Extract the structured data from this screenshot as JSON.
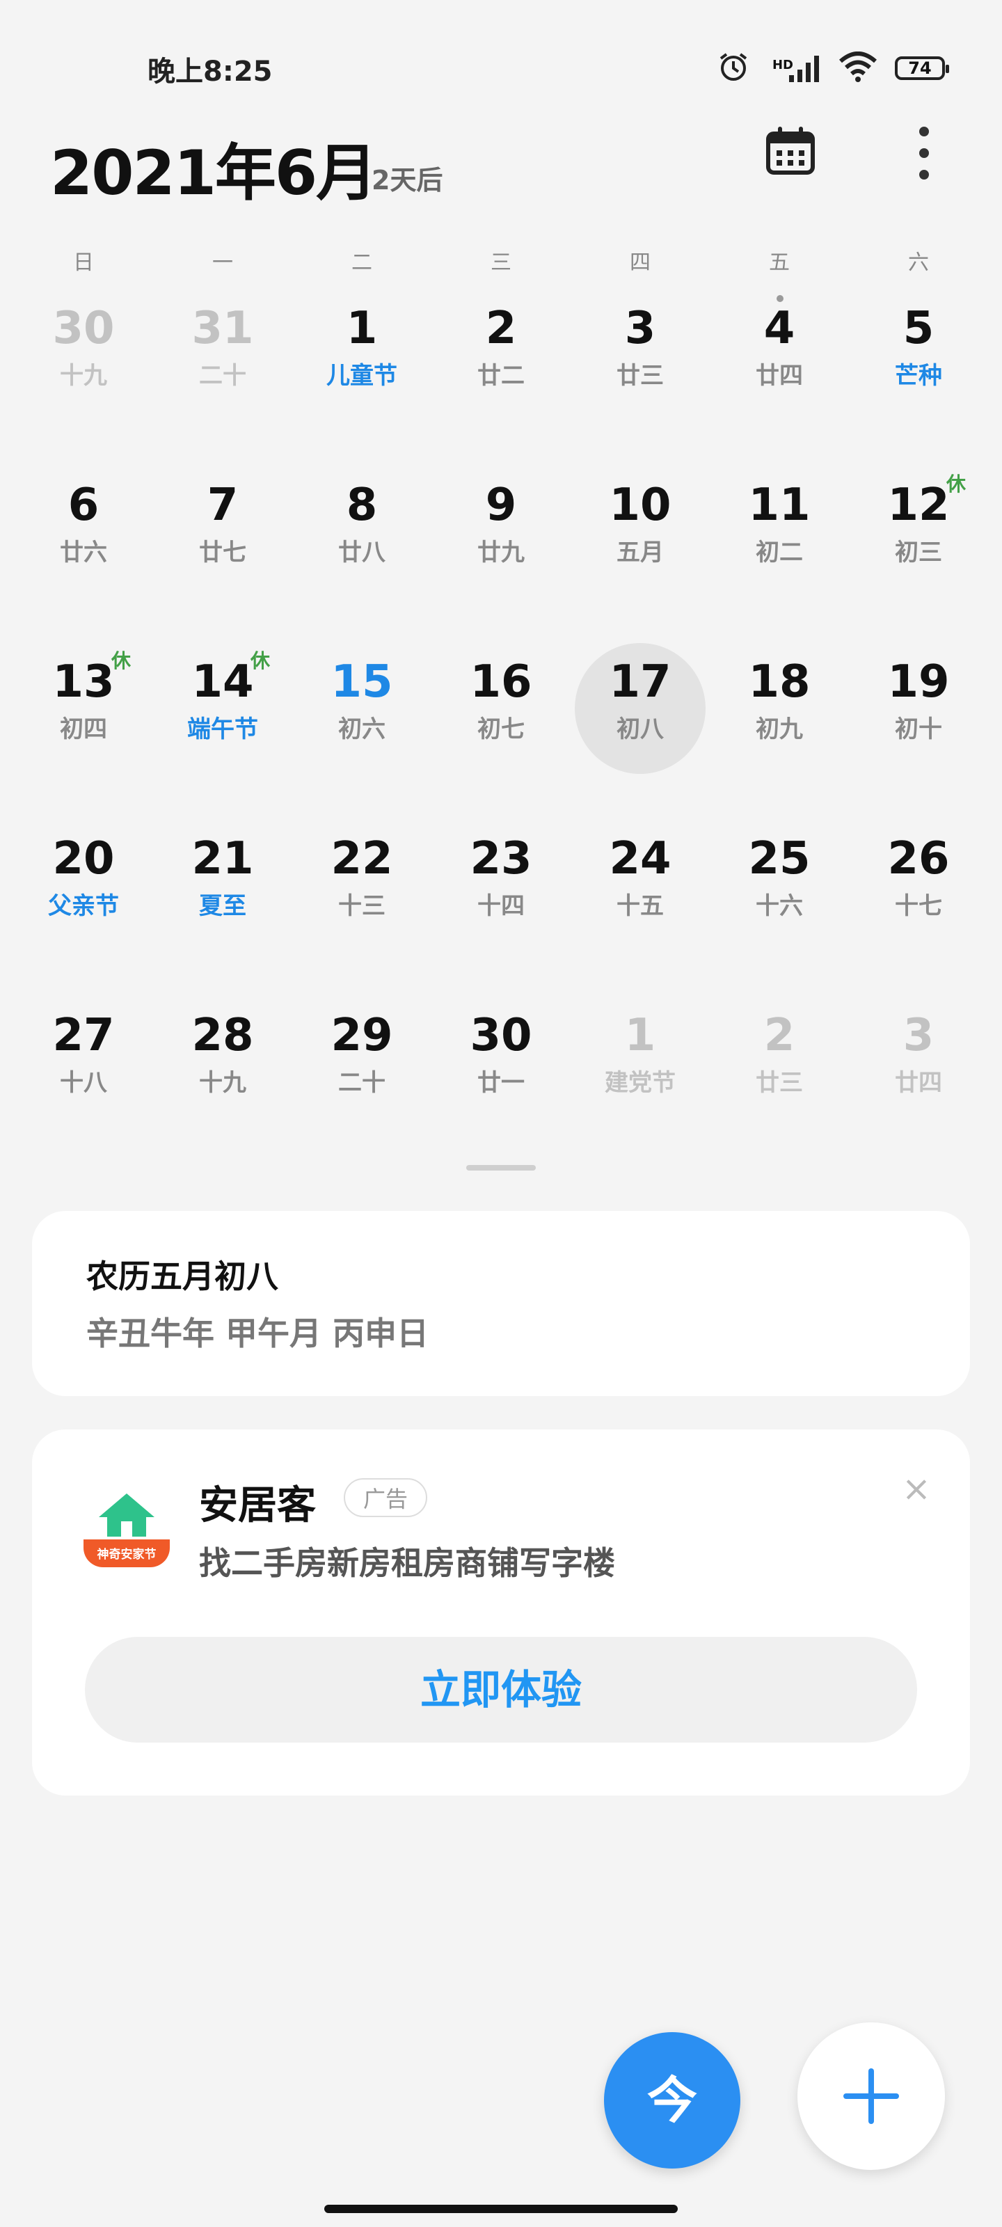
{
  "status_bar": {
    "time": "晚上8:25",
    "network": "HD",
    "battery": "74"
  },
  "header": {
    "title": "2021年6月",
    "subtitle": "2天后"
  },
  "weekdays": [
    "日",
    "一",
    "二",
    "三",
    "四",
    "五",
    "六"
  ],
  "days": [
    {
      "n": "30",
      "l": "十九"
    },
    {
      "n": "31",
      "l": "二十"
    },
    {
      "n": "1",
      "l": "儿童节"
    },
    {
      "n": "2",
      "l": "廿二"
    },
    {
      "n": "3",
      "l": "廿三"
    },
    {
      "n": "4",
      "l": "廿四"
    },
    {
      "n": "5",
      "l": "芒种"
    },
    {
      "n": "6",
      "l": "廿六"
    },
    {
      "n": "7",
      "l": "廿七"
    },
    {
      "n": "8",
      "l": "廿八"
    },
    {
      "n": "9",
      "l": "廿九"
    },
    {
      "n": "10",
      "l": "五月"
    },
    {
      "n": "11",
      "l": "初二"
    },
    {
      "n": "12",
      "l": "初三",
      "rest": "休"
    },
    {
      "n": "13",
      "l": "初四",
      "rest": "休"
    },
    {
      "n": "14",
      "l": "端午节",
      "rest": "休"
    },
    {
      "n": "15",
      "l": "初六"
    },
    {
      "n": "16",
      "l": "初七"
    },
    {
      "n": "17",
      "l": "初八"
    },
    {
      "n": "18",
      "l": "初九"
    },
    {
      "n": "19",
      "l": "初十"
    },
    {
      "n": "20",
      "l": "父亲节"
    },
    {
      "n": "21",
      "l": "夏至"
    },
    {
      "n": "22",
      "l": "十三"
    },
    {
      "n": "23",
      "l": "十四"
    },
    {
      "n": "24",
      "l": "十五"
    },
    {
      "n": "25",
      "l": "十六"
    },
    {
      "n": "26",
      "l": "十七"
    },
    {
      "n": "27",
      "l": "十八"
    },
    {
      "n": "28",
      "l": "十九"
    },
    {
      "n": "29",
      "l": "二十"
    },
    {
      "n": "30",
      "l": "廿一"
    },
    {
      "n": "1",
      "l": "建党节"
    },
    {
      "n": "2",
      "l": "廿三"
    },
    {
      "n": "3",
      "l": "廿四"
    }
  ],
  "lunar_card": {
    "title": "农历五月初八",
    "detail": "辛丑牛年 甲午月 丙申日"
  },
  "ad_card": {
    "app_name": "安居客",
    "tag": "广告",
    "description": "找二手房新房租房商铺写字楼",
    "icon_label": "神奇安家节",
    "cta": "立即体验",
    "close": "×"
  },
  "fab": {
    "today_label": "今"
  },
  "colors": {
    "accent": "#2196f3",
    "holiday": "#1e88e5",
    "rest": "#43a047"
  }
}
